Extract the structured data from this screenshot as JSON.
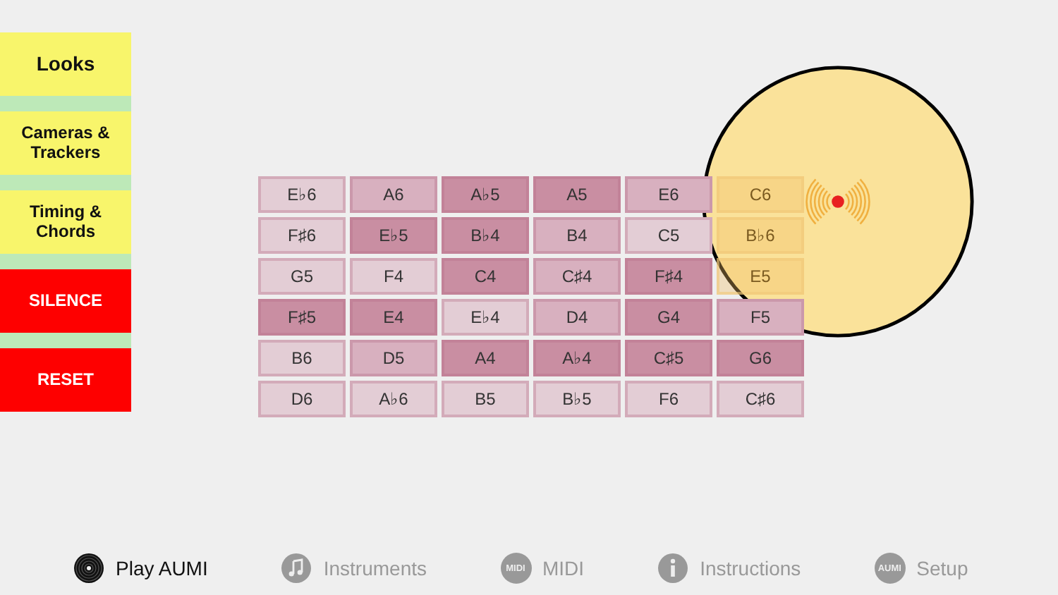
{
  "sidebar": [
    {
      "label": "Looks",
      "kind": "menu"
    },
    {
      "label": "Cameras & Trackers",
      "kind": "menu"
    },
    {
      "label": "Timing & Chords",
      "kind": "menu"
    },
    {
      "label": "SILENCE",
      "kind": "action"
    },
    {
      "label": "RESET",
      "kind": "action"
    }
  ],
  "grid": [
    [
      {
        "note": "E♭6",
        "color": "#e3cdd5"
      },
      {
        "note": "A6",
        "color": "#d8b0bf"
      },
      {
        "note": "A♭5",
        "color": "#c98ea2"
      },
      {
        "note": "A5",
        "color": "#c98ea2"
      },
      {
        "note": "E6",
        "color": "#d8b0bf"
      },
      {
        "note": "C6"
      }
    ],
    [
      {
        "note": "F♯6",
        "color": "#e3cdd5"
      },
      {
        "note": "E♭5",
        "color": "#c98ea2"
      },
      {
        "note": "B♭4",
        "color": "#c98ea2"
      },
      {
        "note": "B4",
        "color": "#d8b0bf"
      },
      {
        "note": "C5",
        "color": "#e3cdd5"
      },
      {
        "note": "B♭6"
      }
    ],
    [
      {
        "note": "G5",
        "color": "#e3cdd5"
      },
      {
        "note": "F4",
        "color": "#e3cdd5"
      },
      {
        "note": "C4",
        "color": "#c98ea2"
      },
      {
        "note": "C♯4",
        "color": "#d8b0bf"
      },
      {
        "note": "F♯4",
        "color": "#c98ea2"
      },
      {
        "note": "E5"
      }
    ],
    [
      {
        "note": "F♯5",
        "color": "#c98ea2"
      },
      {
        "note": "E4",
        "color": "#c98ea2"
      },
      {
        "note": "E♭4",
        "color": "#e3cdd5"
      },
      {
        "note": "D4",
        "color": "#d8b0bf"
      },
      {
        "note": "G4",
        "color": "#c98ea2"
      },
      {
        "note": "F5",
        "color": "#d8b0bf"
      }
    ],
    [
      {
        "note": "B6",
        "color": "#e3cdd5"
      },
      {
        "note": "D5",
        "color": "#d8b0bf"
      },
      {
        "note": "A4",
        "color": "#c98ea2"
      },
      {
        "note": "A♭4",
        "color": "#c98ea2"
      },
      {
        "note": "C♯5",
        "color": "#c98ea2"
      },
      {
        "note": "G6",
        "color": "#c98ea2"
      }
    ],
    [
      {
        "note": "D6",
        "color": "#e3cdd5"
      },
      {
        "note": "A♭6",
        "color": "#e3cdd5"
      },
      {
        "note": "B5",
        "color": "#e3cdd5"
      },
      {
        "note": "B♭5",
        "color": "#e3cdd5"
      },
      {
        "note": "F6",
        "color": "#e3cdd5"
      },
      {
        "note": "C♯6",
        "color": "#e3cdd5"
      }
    ]
  ],
  "tabs": [
    {
      "label": "Play AUMI",
      "kind": "record",
      "selected": true
    },
    {
      "label": "Instruments",
      "kind": "note",
      "selected": false
    },
    {
      "label": "MIDI",
      "kind": "badge",
      "badge": "MIDI",
      "selected": false
    },
    {
      "label": "Instructions",
      "kind": "info",
      "selected": false
    },
    {
      "label": "Setup",
      "kind": "badge",
      "badge": "AUMI",
      "selected": false
    }
  ]
}
